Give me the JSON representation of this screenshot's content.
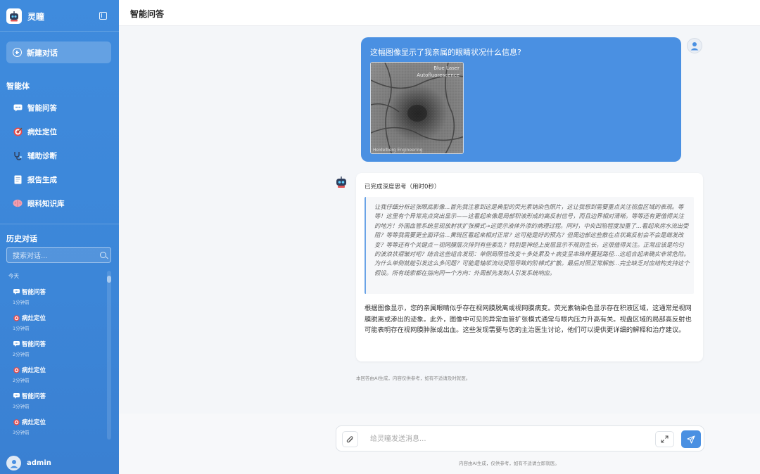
{
  "sidebar": {
    "brand_name": "灵瞳",
    "new_chat_label": "新建对话",
    "agents_title": "智能体",
    "agents": [
      {
        "label": "智能问答",
        "icon": "chat-bubble-icon"
      },
      {
        "label": "病灶定位",
        "icon": "target-icon"
      },
      {
        "label": "辅助诊断",
        "icon": "stethoscope-icon"
      },
      {
        "label": "报告生成",
        "icon": "document-icon"
      },
      {
        "label": "眼科知识库",
        "icon": "brain-icon"
      }
    ],
    "history_title": "历史对话",
    "search_placeholder": "搜索对话...",
    "history_group": "今天",
    "history": [
      {
        "title": "智能问答",
        "time": "1分钟前",
        "icon": "chat-bubble-icon"
      },
      {
        "title": "病灶定位",
        "time": "1分钟前",
        "icon": "target-icon"
      },
      {
        "title": "智能问答",
        "time": "2分钟前",
        "icon": "chat-bubble-icon"
      },
      {
        "title": "病灶定位",
        "time": "2分钟前",
        "icon": "target-icon"
      },
      {
        "title": "智能问答",
        "time": "3分钟前",
        "icon": "chat-bubble-icon"
      },
      {
        "title": "病灶定位",
        "time": "3分钟前",
        "icon": "target-icon"
      }
    ],
    "user_name": "admin"
  },
  "header": {
    "title": "智能问答"
  },
  "conversation": {
    "user_question": "这幅图像显示了我亲属的眼睛状况什么信息?",
    "image_label_line1": "Blue Laser",
    "image_label_line2": "Autofluorescence",
    "image_watermark": "Heidelberg Engineering",
    "think_status": "已完成深度思考（用时0秒）",
    "thinking": "让我仔细分析这张眼底影像...首先我注意到这是典型的荧光素钠染色照片，这让我想到需要重点关注视盘区域的表现。等等！这里有个异常亮点突出显示——这看起来像是局部积液形成的高反射信号，而且边界相对清晰。等等还有更值得关注的地方！外围血管系统呈现放射状扩张模式→这提示液体外渗的病理过程。同时，中央凹陷程度加重了...看起来房水流出受阻？等等我需要更全面评估...黄斑区看起来相对正常？这可能是好的预兆？但周边部这些散在点状高反射会不会是继发改变？等等还有个关键点－视网膜层次排列有些紊乱？特别是神经上皮层显示不规则生长，这很值得关注。正常应该是均匀的波浪状褶皱对吧？结合这些组合发现：单侧局限性改变＋多处累及＋病变呈串珠样蔓延路径...这组合起来确实非常危险。为什么单侧就能引发这么多问题？可能是轴浆流动受阻导致的阶梯式扩散。最后对照正常解剖...完全缺乏对应结构支持这个假设。所有线索都在指向同一个方向：外周部先发制人引发系统响应。",
    "answer": "根据图像显示，您的亲属眼睛似乎存在视网膜脱离或视网膜病变。荧光素钠染色显示存在积液区域，这通常是视网膜脱离或渗出的迹象。此外，图像中可见的异常血管扩张模式通常与眼内压力升高有关。视盘区域的局部高反射也可能表明存在视网膜肿胀或出血。这些发现需要与您的主治医生讨论，他们可以提供更详细的解释和治疗建议。",
    "disclaimer": "本回答由AI生成，内容仅供参考，如有不适请及时就医。"
  },
  "composer": {
    "placeholder": "给灵瞳发送消息...",
    "footer_note": "内容由AI生成，仅供参考，如有不适请立即就医。"
  },
  "colors": {
    "accent": "#4a90e2",
    "sidebar": "#3c86d8"
  }
}
